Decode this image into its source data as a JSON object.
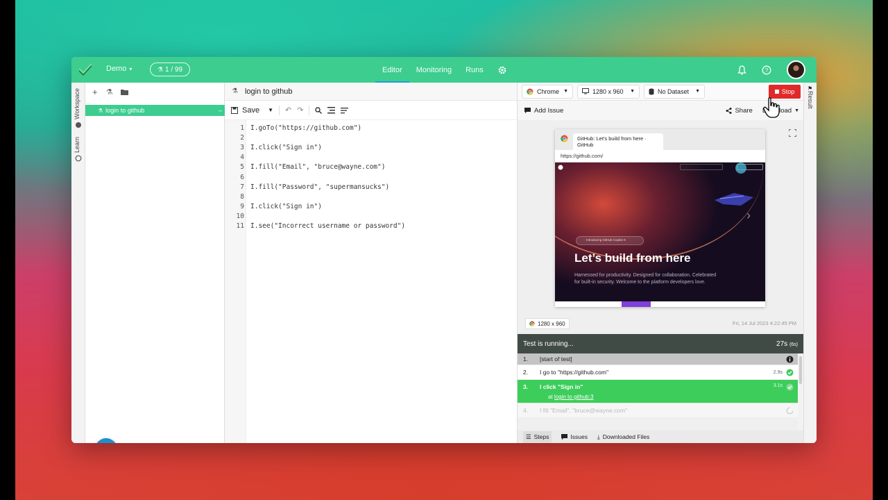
{
  "topbar": {
    "project": "Demo",
    "tests_count": "1 / 99",
    "tabs": [
      "Editor",
      "Monitoring",
      "Runs"
    ],
    "active_tab": "Editor",
    "brand_color": "#3ccd8f"
  },
  "rail": {
    "workspace": "Workspace",
    "learn": "Learn"
  },
  "workspace": {
    "items": [
      "login to github"
    ]
  },
  "editor": {
    "title": "login to github",
    "save_label": "Save",
    "lines": [
      {
        "n": "1",
        "code": "I.goTo(\"https://github.com\")"
      },
      {
        "n": "2",
        "code": ""
      },
      {
        "n": "3",
        "code": "I.click(\"Sign in\")"
      },
      {
        "n": "4",
        "code": ""
      },
      {
        "n": "5",
        "code": "I.fill(\"Email\", \"bruce@wayne.com\")"
      },
      {
        "n": "6",
        "code": ""
      },
      {
        "n": "7",
        "code": "I.fill(\"Password\", \"supermansucks\")"
      },
      {
        "n": "8",
        "code": ""
      },
      {
        "n": "9",
        "code": "I.click(\"Sign in\")"
      },
      {
        "n": "10",
        "code": ""
      },
      {
        "n": "11",
        "code": "I.see(\"Incorrect username or password\")"
      }
    ]
  },
  "runner": {
    "browser": "Chrome",
    "resolution": "1280 x 960",
    "dataset": "No Dataset",
    "stop_label": "Stop",
    "add_issue": "Add Issue",
    "share": "Share",
    "download": "Download",
    "result_rail": "Result",
    "preview": {
      "tab_title": "GitHub: Let's build from here · GitHub",
      "url": "https://github.com/",
      "headline": "Let’s build from here",
      "subtext": "Harnessed for productivity. Designed for collaboration. Celebrated for built-in security. Welcome to the platform developers love.",
      "pill": "Introducing GitHub Copilot X"
    },
    "resolution_badge": "1280 x 960",
    "timestamp": "Fri, 14 Jul 2023 4:22:45 PM",
    "status": "Test is running...",
    "elapsed": "27s",
    "elapsed_detail": "(6s)",
    "steps": [
      {
        "idx": "1.",
        "text": "[start of test]",
        "dur": "",
        "state": "header"
      },
      {
        "idx": "2.",
        "text": "I go to \"https://github.com\"",
        "dur": "2.9s",
        "state": "passed"
      },
      {
        "idx": "3.",
        "text": "I click \"Sign in\"",
        "dur": "3.1s",
        "state": "active",
        "location_prefix": "at",
        "location": "login to github:3"
      },
      {
        "idx": "4.",
        "text": "I fill \"Email\", \"bruce@wayne.com\"",
        "dur": "",
        "state": "pending"
      }
    ],
    "bottom_tabs": [
      "Steps",
      "Issues",
      "Downloaded Files"
    ]
  }
}
